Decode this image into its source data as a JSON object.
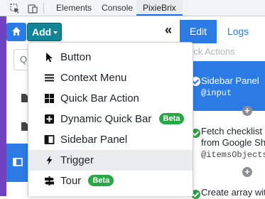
{
  "devtools": {
    "tabs": [
      "Elements",
      "Console",
      "PixieBrix"
    ],
    "active_tab": "PixieBrix",
    "icons": [
      "inspect-element-icon",
      "device-toolbar-icon"
    ]
  },
  "toolbar": {
    "home_icon": "home-icon",
    "add_label": "Add",
    "collapse_glyph": "«",
    "edit_label": "Edit",
    "logs_label": "Logs",
    "accent_color": "#2c7be5",
    "add_color": "#138496"
  },
  "left_panel": {
    "search_stub": "Q"
  },
  "add_menu": {
    "items": [
      {
        "label": "Button",
        "icon": "cursor-icon"
      },
      {
        "label": "Context Menu",
        "icon": "menu-lines-icon"
      },
      {
        "label": "Quick Bar Action",
        "icon": "grid-icon"
      },
      {
        "label": "Dynamic Quick Bar",
        "icon": "plus-square-icon",
        "badge": "Beta"
      },
      {
        "label": "Sidebar Panel",
        "icon": "sidebar-icon"
      },
      {
        "label": "Trigger",
        "icon": "bolt-icon",
        "hovered": true
      },
      {
        "label": "Tour",
        "icon": "signpost-icon",
        "badge": "Beta"
      }
    ],
    "badge_color": "#28a745"
  },
  "bricks": {
    "heading": "rick Actions",
    "items": [
      {
        "line1": "Sidebar Panel",
        "line2": "@input",
        "selected": true
      },
      {
        "line1": "Fetch checklist",
        "line2": "from Google Sh",
        "line3": "@itemsObjects"
      },
      {
        "line1": "Create array wit",
        "line2": "",
        "line3": ""
      }
    ]
  }
}
